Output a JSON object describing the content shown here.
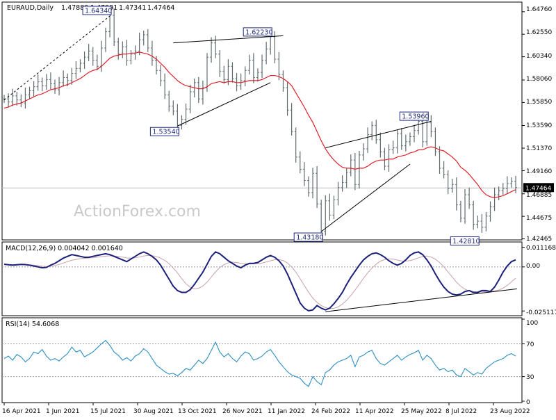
{
  "chart_data": [
    {
      "type": "ohlc",
      "title": "EURAUD,Daily",
      "ohlc_readout": [
        "1.47880",
        "1.47991",
        "1.47341",
        "1.47464"
      ],
      "watermark": "ActionForex.com",
      "ylim": [
        1.425,
        1.655
      ],
      "y_ticks": [
        "1.64760",
        "1.62550",
        "1.60340",
        "1.58060",
        "1.55850",
        "1.53590",
        "1.51370",
        "1.49160",
        "1.46885",
        "1.44675",
        "1.42465"
      ],
      "y_tick_values": [
        1.6476,
        1.6255,
        1.6034,
        1.5806,
        1.5585,
        1.5359,
        1.5137,
        1.4916,
        1.46885,
        1.44675,
        1.42465
      ],
      "last_price_label": "1.47464",
      "last_price": 1.47464,
      "x_ticks": [
        "16 Apr 2021",
        "1 Jun 2021",
        "15 Jul 2021",
        "30 Aug 2021",
        "13 Oct 2021",
        "26 Nov 2021",
        "11 Jan 2022",
        "24 Feb 2022",
        "11 Apr 2022",
        "25 May 2022",
        "8 Jul 2022",
        "23 Aug 2022"
      ],
      "close_series": [
        1.562,
        1.559,
        1.565,
        1.561,
        1.558,
        1.566,
        1.57,
        1.574,
        1.579,
        1.575,
        1.581,
        1.577,
        1.571,
        1.578,
        1.583,
        1.58,
        1.587,
        1.592,
        1.597,
        1.603,
        1.609,
        1.6,
        1.594,
        1.612,
        1.628,
        1.644,
        1.618,
        1.606,
        1.613,
        1.6,
        1.606,
        1.609,
        1.62,
        1.625,
        1.612,
        1.6,
        1.59,
        1.58,
        1.566,
        1.555,
        1.55,
        1.536,
        1.542,
        1.552,
        1.569,
        1.578,
        1.562,
        1.573,
        1.603,
        1.617,
        1.606,
        1.589,
        1.581,
        1.594,
        1.582,
        1.575,
        1.58,
        1.59,
        1.6,
        1.583,
        1.588,
        1.6,
        1.611,
        1.623,
        1.601,
        1.586,
        1.573,
        1.551,
        1.53,
        1.505,
        1.493,
        1.482,
        1.47,
        1.489,
        1.459,
        1.432,
        1.462,
        1.448,
        1.463,
        1.475,
        1.48,
        1.49,
        1.502,
        1.478,
        1.507,
        1.513,
        1.527,
        1.536,
        1.522,
        1.51,
        1.496,
        1.512,
        1.514,
        1.528,
        1.516,
        1.52,
        1.525,
        1.531,
        1.54,
        1.52,
        1.539,
        1.53,
        1.51,
        1.494,
        1.488,
        1.474,
        1.478,
        1.458,
        1.445,
        1.468,
        1.458,
        1.439,
        1.442,
        1.436,
        1.447,
        1.456,
        1.468,
        1.472,
        1.474,
        1.479,
        1.481,
        1.475
      ],
      "ma_series": [
        1.553,
        1.554,
        1.556,
        1.557,
        1.558,
        1.56,
        1.562,
        1.564,
        1.566,
        1.567,
        1.569,
        1.571,
        1.572,
        1.573,
        1.575,
        1.576,
        1.578,
        1.58,
        1.582,
        1.585,
        1.588,
        1.59,
        1.591,
        1.594,
        1.598,
        1.602,
        1.604,
        1.605,
        1.606,
        1.606,
        1.607,
        1.607,
        1.608,
        1.607,
        1.606,
        1.604,
        1.601,
        1.597,
        1.593,
        1.588,
        1.584,
        1.58,
        1.577,
        1.575,
        1.574,
        1.573,
        1.572,
        1.572,
        1.574,
        1.577,
        1.578,
        1.579,
        1.578,
        1.579,
        1.579,
        1.578,
        1.578,
        1.579,
        1.58,
        1.58,
        1.58,
        1.581,
        1.583,
        1.585,
        1.585,
        1.584,
        1.582,
        1.579,
        1.575,
        1.568,
        1.561,
        1.554,
        1.546,
        1.539,
        1.53,
        1.521,
        1.513,
        1.507,
        1.502,
        1.498,
        1.495,
        1.494,
        1.494,
        1.493,
        1.494,
        1.494,
        1.496,
        1.499,
        1.501,
        1.502,
        1.502,
        1.503,
        1.503,
        1.505,
        1.506,
        1.507,
        1.509,
        1.51,
        1.512,
        1.512,
        1.514,
        1.515,
        1.514,
        1.512,
        1.511,
        1.508,
        1.505,
        1.501,
        1.495,
        1.492,
        1.488,
        1.483,
        1.478,
        1.472,
        1.468,
        1.466,
        1.465,
        1.466,
        1.467,
        1.469,
        1.471,
        1.473
      ],
      "annotations": [
        {
          "label": "1.64340",
          "index": 25,
          "price": 1.6434,
          "side": "above"
        },
        {
          "label": "1.62230",
          "index": 63,
          "price": 1.6223,
          "side": "above"
        },
        {
          "label": "1.53540",
          "index": 41,
          "price": 1.5354,
          "side": "below"
        },
        {
          "label": "1.43180",
          "index": 75,
          "price": 1.4318,
          "side": "below"
        },
        {
          "label": "1.53960",
          "index": 100,
          "price": 1.5396,
          "side": "above"
        },
        {
          "label": "1.42810",
          "index": 112,
          "price": 1.4281,
          "side": "below"
        }
      ],
      "trendlines": [
        {
          "from": [
            0,
            1.561
          ],
          "to": [
            25,
            1.6434
          ],
          "style": "dashed"
        },
        {
          "from": [
            41,
            1.5354
          ],
          "to": [
            63,
            1.578
          ],
          "style": "solid"
        },
        {
          "from": [
            40,
            1.617
          ],
          "to": [
            66,
            1.624
          ],
          "style": "solid"
        },
        {
          "from": [
            75,
            1.4318
          ],
          "to": [
            96,
            1.498
          ],
          "style": "solid"
        },
        {
          "from": [
            76,
            1.514
          ],
          "to": [
            101,
            1.54
          ],
          "style": "solid"
        }
      ]
    },
    {
      "type": "line",
      "title": "MACD(12,26,9) 0.004042 0.001640",
      "ylim": [
        -0.027,
        0.013
      ],
      "y_ticks": [
        "0.011168",
        "0.00",
        "-0.025117"
      ],
      "y_tick_values": [
        0.011168,
        0.0,
        -0.025117
      ],
      "zero_line": 0,
      "series": [
        {
          "values": [
            0.0015,
            0.0012,
            0.001,
            0.0012,
            0.0014,
            0.0013,
            0.001,
            0.0005,
            0.0,
            -0.0005,
            -0.0003,
            0.001,
            0.002,
            0.0035,
            0.005,
            0.006,
            0.007,
            0.0065,
            0.006,
            0.0055,
            0.0055,
            0.006,
            0.0065,
            0.007,
            0.0075,
            0.007,
            0.006,
            0.005,
            0.004,
            0.003,
            0.0045,
            0.006,
            0.0075,
            0.0085,
            0.0075,
            0.006,
            0.004,
            0.001,
            -0.003,
            -0.007,
            -0.011,
            -0.0135,
            -0.0145,
            -0.0145,
            -0.013,
            -0.01,
            -0.0065,
            -0.003,
            0.0015,
            0.006,
            0.0085,
            0.0075,
            0.0055,
            0.0035,
            0.002,
            0.0005,
            -0.0005,
            0.001,
            0.002,
            0.002,
            0.0025,
            0.004,
            0.0055,
            0.0065,
            0.0055,
            0.0035,
            0.0005,
            -0.004,
            -0.0095,
            -0.015,
            -0.0205,
            -0.0235,
            -0.025,
            -0.0245,
            -0.022,
            -0.0235,
            -0.0245,
            -0.0235,
            -0.021,
            -0.018,
            -0.0145,
            -0.01,
            -0.006,
            -0.0025,
            0.001,
            0.004,
            0.006,
            0.0075,
            0.008,
            0.007,
            0.0055,
            0.0035,
            0.002,
            0.001,
            0.002,
            0.004,
            0.0065,
            0.008,
            0.0085,
            0.007,
            0.004,
            0.0005,
            -0.004,
            -0.008,
            -0.0115,
            -0.014,
            -0.0155,
            -0.016,
            -0.0155,
            -0.014,
            -0.0135,
            -0.0145,
            -0.0145,
            -0.0135,
            -0.0135,
            -0.014,
            -0.0115,
            -0.0075,
            -0.003,
            0.0005,
            0.003,
            0.004
          ]
        },
        {
          "values": [
            0.0014,
            0.0013,
            0.0012,
            0.0012,
            0.0013,
            0.0013,
            0.0012,
            0.001,
            0.0007,
            0.0004,
            0.0002,
            0.0004,
            0.0008,
            0.0014,
            0.0022,
            0.003,
            0.0038,
            0.0043,
            0.0047,
            0.0049,
            0.0051,
            0.0053,
            0.0055,
            0.0058,
            0.0061,
            0.0063,
            0.0062,
            0.006,
            0.0056,
            0.0051,
            0.005,
            0.0052,
            0.0056,
            0.0062,
            0.0065,
            0.0064,
            0.0059,
            0.005,
            0.0037,
            0.0019,
            -0.0007,
            -0.0034,
            -0.0067,
            -0.0096,
            -0.0116,
            -0.0125,
            -0.0122,
            -0.0109,
            -0.0087,
            -0.0058,
            -0.0028,
            -0.0004,
            0.0013,
            0.0023,
            0.0027,
            0.0025,
            0.002,
            0.0017,
            0.0017,
            0.0018,
            0.0019,
            0.0022,
            0.0028,
            0.0035,
            0.0041,
            0.0042,
            0.0036,
            0.0022,
            0.0,
            -0.003,
            -0.0067,
            -0.0106,
            -0.0144,
            -0.0177,
            -0.0202,
            -0.022,
            -0.0232,
            -0.0238,
            -0.0236,
            -0.0228,
            -0.0212,
            -0.019,
            -0.0163,
            -0.0132,
            -0.0099,
            -0.0065,
            -0.0034,
            -0.0007,
            0.0016,
            0.0033,
            0.0042,
            0.0046,
            0.0045,
            0.0039,
            0.0034,
            0.0033,
            0.0036,
            0.0043,
            0.0052,
            0.0059,
            0.0062,
            0.0056,
            0.0044,
            0.0025,
            0.0001,
            -0.0029,
            -0.0058,
            -0.0087,
            -0.011,
            -0.0127,
            -0.0137,
            -0.0142,
            -0.0143,
            -0.0143,
            -0.0141,
            -0.014,
            -0.0137,
            -0.0132,
            -0.0121,
            -0.0105,
            -0.0085,
            -0.0064
          ]
        }
      ],
      "trendlines": [
        {
          "from": [
            76,
            -0.0255
          ],
          "to": [
            120,
            -0.0125
          ],
          "style": "solid"
        }
      ]
    },
    {
      "type": "line",
      "title": "RSI(14) 54.6068",
      "ylim": [
        0,
        100
      ],
      "y_ticks": [
        "100",
        "70",
        "30",
        "0"
      ],
      "y_tick_values": [
        100,
        70,
        30,
        0
      ],
      "levels": [
        70,
        30
      ],
      "series": [
        {
          "values": [
            52,
            55,
            50,
            57,
            54,
            48,
            52,
            60,
            58,
            63,
            55,
            50,
            52,
            49,
            54,
            58,
            66,
            60,
            62,
            54,
            57,
            60,
            65,
            70,
            74,
            68,
            60,
            56,
            50,
            53,
            49,
            55,
            58,
            64,
            60,
            52,
            44,
            40,
            36,
            33,
            34,
            31,
            35,
            40,
            38,
            44,
            50,
            46,
            52,
            62,
            72,
            60,
            54,
            58,
            52,
            48,
            55,
            60,
            58,
            50,
            52,
            55,
            60,
            63,
            56,
            48,
            42,
            36,
            32,
            30,
            28,
            22,
            18,
            30,
            24,
            20,
            35,
            38,
            44,
            48,
            50,
            52,
            56,
            42,
            54,
            56,
            60,
            62,
            52,
            46,
            44,
            48,
            52,
            56,
            50,
            54,
            57,
            59,
            62,
            50,
            56,
            52,
            44,
            38,
            40,
            36,
            38,
            32,
            30,
            40,
            36,
            32,
            35,
            33,
            40,
            44,
            48,
            50,
            52,
            56,
            58,
            55
          ]
        }
      ]
    }
  ]
}
